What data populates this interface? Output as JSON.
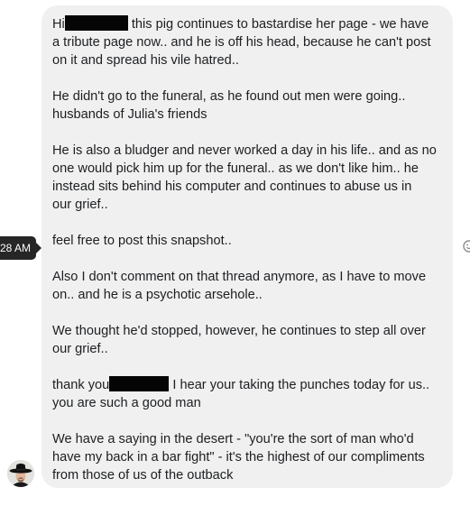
{
  "timestamp": "28 AM",
  "message": {
    "paragraphs": [
      {
        "lines": [
          {
            "before": "Hi",
            "redact_width": 70,
            "after": " this pig continues to bastardise her page - we have"
          },
          {
            "text": "a tribute page now.. and he is off his head, because he can't post"
          },
          {
            "text": "on it and spread his vile hatred.."
          }
        ]
      },
      {
        "lines": [
          {
            "text": "He didn't go to the funeral, as he found out men were going.."
          },
          {
            "text": "husbands of Julia's friends"
          }
        ]
      },
      {
        "lines": [
          {
            "text": "He is also a bludger and never worked a day in his life.. and as no"
          },
          {
            "text": "one would pick him up for the funeral.. as we don't like him.. he"
          },
          {
            "text": "instead sits behind his computer and continues to abuse us in"
          },
          {
            "text": "our grief.."
          }
        ]
      },
      {
        "lines": [
          {
            "text": "feel free to post this snapshot.."
          }
        ]
      },
      {
        "lines": [
          {
            "text": "Also I don't comment on that thread anymore, as I have to move"
          },
          {
            "text": "on.. and he is a psychotic arsehole.."
          }
        ]
      },
      {
        "lines": [
          {
            "text": "We thought he'd stopped, however, he continues to step all over"
          },
          {
            "text": "our grief.."
          }
        ]
      },
      {
        "lines": [
          {
            "before": "thank you",
            "redact_width": 66,
            "after": " I hear your taking the punches today for us.."
          },
          {
            "text": "you are such a good man"
          }
        ]
      },
      {
        "lines": [
          {
            "text": "We have a saying in the desert - \"you're the sort of man who'd"
          },
          {
            "text": "have my back in a bar fight\" - it's the highest of our compliments"
          },
          {
            "text": "from those of us of the outback"
          }
        ]
      }
    ]
  },
  "icons": {
    "react": "smiley-face-icon",
    "avatar": "cowboy-hat-avatar"
  }
}
